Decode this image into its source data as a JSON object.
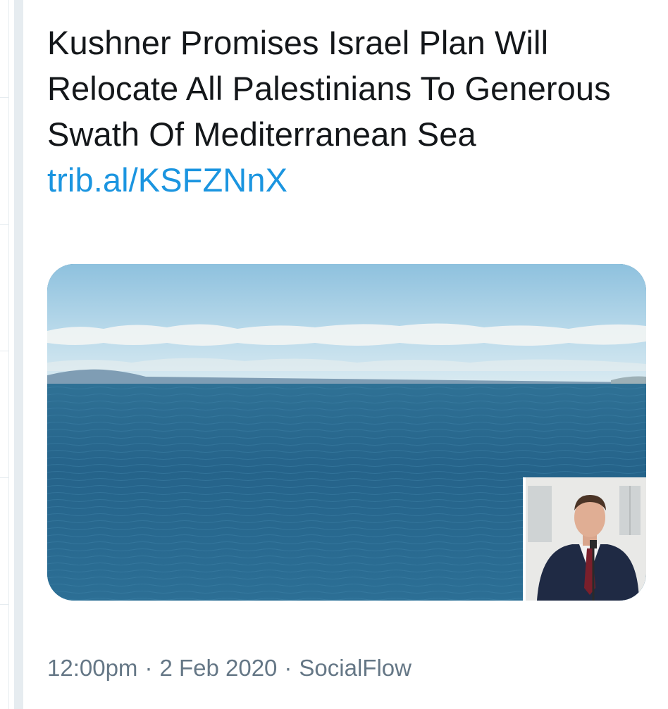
{
  "tweet": {
    "headline": "Kushner Promises Israel Plan Will Relocate All Palestinians To Generous Swath Of Mediterranean Sea",
    "link_text": "trib.al/KSFZNnX"
  },
  "media": {
    "image_icon": "sea-photo",
    "inset_icon": "speaker-photo"
  },
  "meta": {
    "time": "12:00pm",
    "date": "2 Feb 2020",
    "source": "SocialFlow",
    "separator": "·"
  },
  "colors": {
    "text": "#14171a",
    "link": "#1b95e0",
    "meta": "#657786",
    "rail": "#e6ecf0"
  }
}
